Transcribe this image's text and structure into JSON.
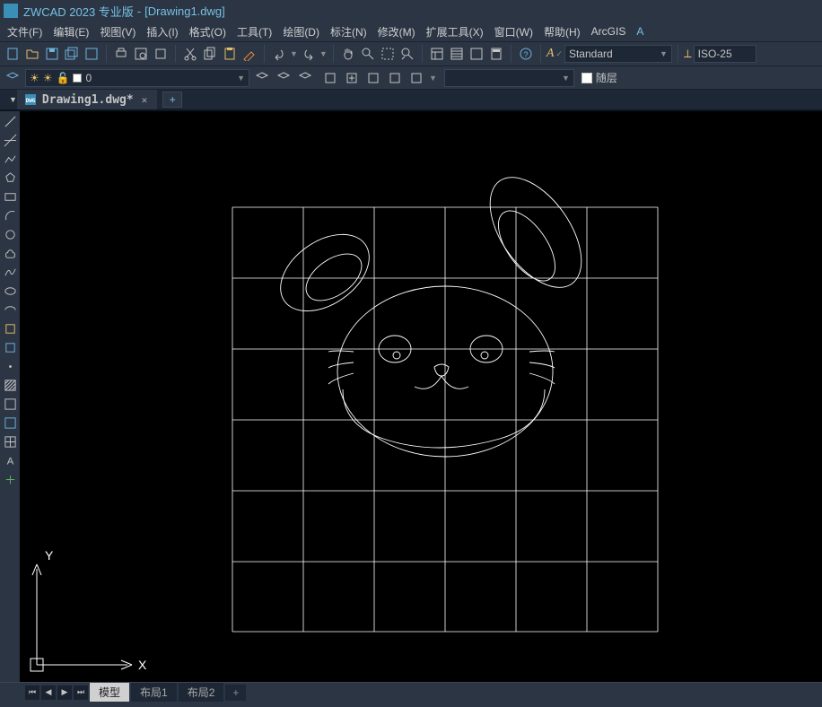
{
  "title_bar": {
    "app": "ZWCAD 2023 专业版",
    "doc": "[Drawing1.dwg]"
  },
  "menu": {
    "file": "文件(F)",
    "edit": "编辑(E)",
    "view": "视图(V)",
    "insert": "插入(I)",
    "format": "格式(O)",
    "tools": "工具(T)",
    "draw": "绘图(D)",
    "dimension": "标注(N)",
    "modify": "修改(M)",
    "ext": "扩展工具(X)",
    "window": "窗口(W)",
    "help": "帮助(H)",
    "arcgis": "ArcGIS"
  },
  "styles": {
    "text_style": "Standard",
    "dim_style": "ISO-25"
  },
  "layer": {
    "current": "0",
    "color_mode": "随层"
  },
  "tab": {
    "name": "Drawing1.dwg*"
  },
  "layout": {
    "model": "模型",
    "l1": "布局1",
    "l2": "布局2",
    "add": "+"
  },
  "ucs": {
    "x": "X",
    "y": "Y"
  }
}
